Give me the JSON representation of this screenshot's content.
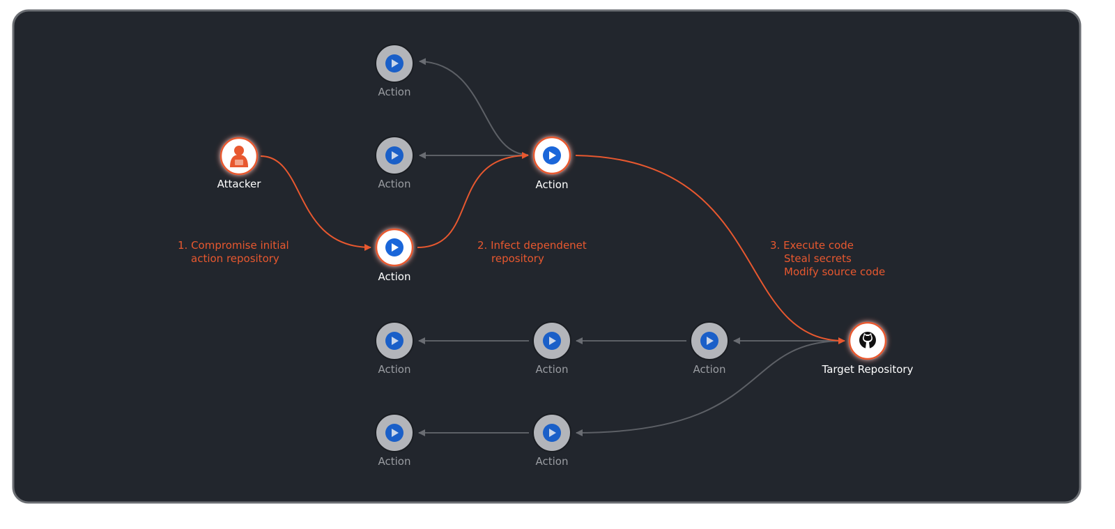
{
  "colors": {
    "background": "#22262d",
    "accent": "#e8582f",
    "inactive_node": "#b3b5ba",
    "play_blue": "#1a5fc8",
    "edge_gray": "#5d6066"
  },
  "nodes": {
    "attacker": {
      "label": "Attacker",
      "icon": "hacker-icon"
    },
    "action_top": {
      "label": "Action",
      "icon": "play-icon",
      "state": "inactive"
    },
    "action_mid_left": {
      "label": "Action",
      "icon": "play-icon",
      "state": "inactive"
    },
    "action_compromised": {
      "label": "Action",
      "icon": "play-icon",
      "state": "active"
    },
    "action_infected": {
      "label": "Action",
      "icon": "play-icon",
      "state": "active"
    },
    "target": {
      "label": "Target Repository",
      "icon": "github-icon"
    },
    "row4_a": {
      "label": "Action",
      "icon": "play-icon",
      "state": "inactive"
    },
    "row4_b": {
      "label": "Action",
      "icon": "play-icon",
      "state": "inactive"
    },
    "row4_c": {
      "label": "Action",
      "icon": "play-icon",
      "state": "inactive"
    },
    "row5_a": {
      "label": "Action",
      "icon": "play-icon",
      "state": "inactive"
    },
    "row5_b": {
      "label": "Action",
      "icon": "play-icon",
      "state": "inactive"
    }
  },
  "annotations": {
    "step1": [
      "1. Compromise initial",
      "action repository"
    ],
    "step2": [
      "2. Infect dependenet",
      "repository"
    ],
    "step3": [
      "3. Execute code",
      "Steal secrets",
      "Modify source code"
    ]
  }
}
